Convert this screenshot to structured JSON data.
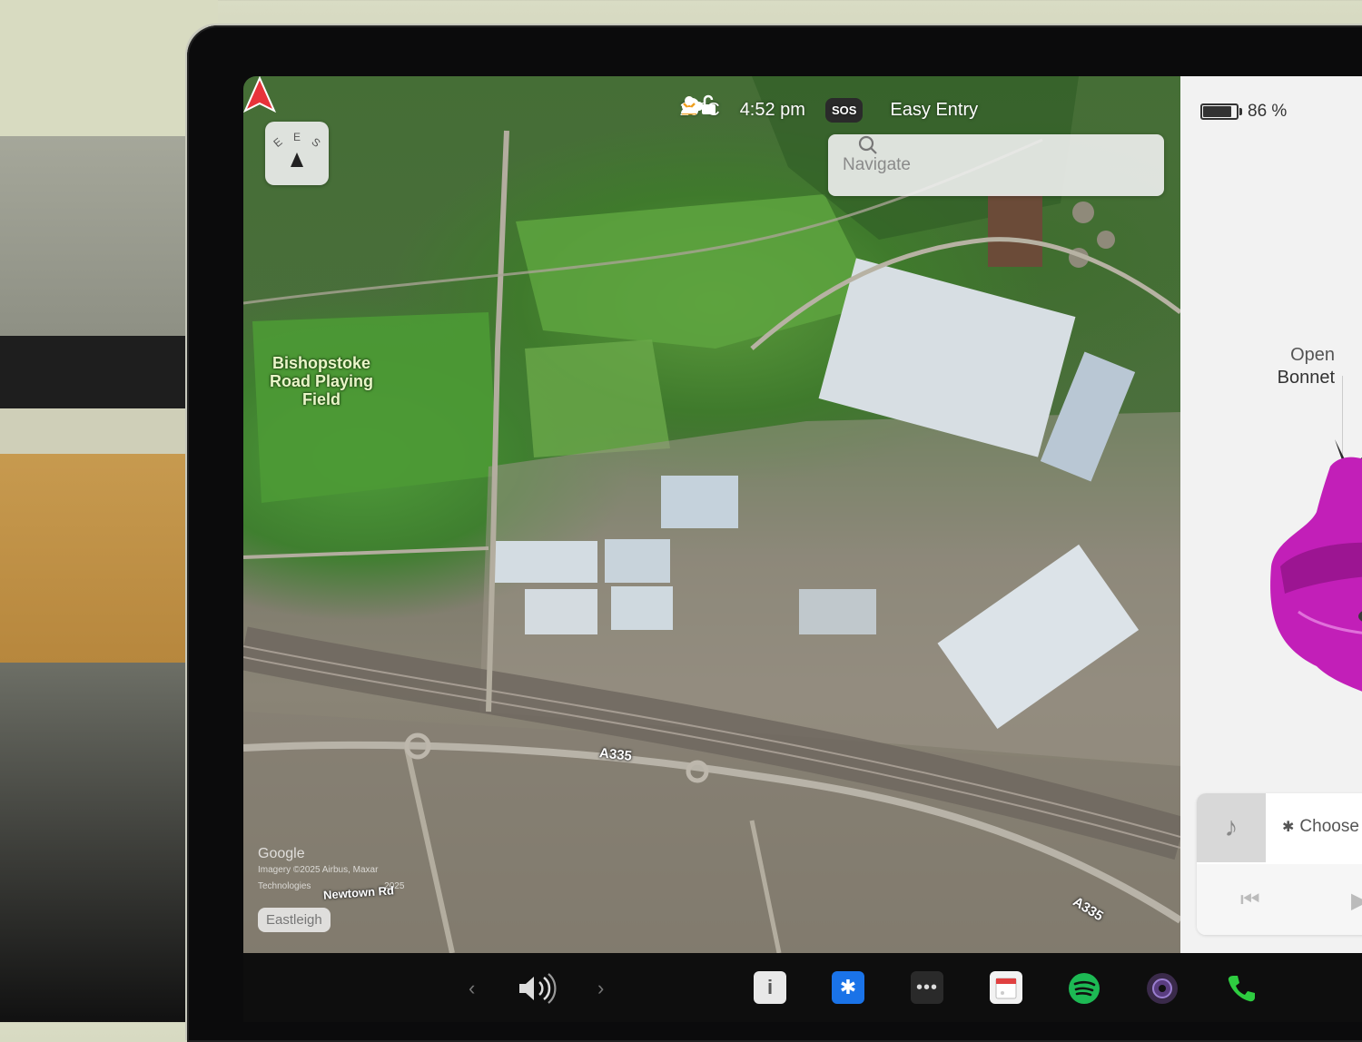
{
  "status_bar": {
    "temperature": "19°C",
    "time": "4:52 pm",
    "sos_label": "SOS",
    "profile_name": "Easy Entry"
  },
  "navigate": {
    "placeholder": "Navigate"
  },
  "compass": {
    "letters": [
      "E",
      "E",
      "S"
    ]
  },
  "map": {
    "place_label": "Bishopstoke Road Playing Field",
    "road_labels": [
      "A335",
      "A335",
      "Newtown Rd"
    ],
    "attribution_brand": "Google",
    "attribution_line1": "Imagery ©2025 Airbus, Maxar",
    "attribution_line2": "Technologies",
    "attribution_year": "2025",
    "city_chip": "Eastleigh"
  },
  "panel": {
    "battery_percent": "86 %",
    "battery_level": 0.86,
    "bonnet_line1": "Open",
    "bonnet_line2": "Bonnet",
    "media_source": "Choose"
  },
  "colors": {
    "position_arrow": "#e8333a",
    "car_body": "#c21fb8",
    "download_icon": "#f0a020",
    "bluetooth_tile": "#1a73e8",
    "spotify": "#1db954",
    "phone": "#2ecc40"
  },
  "dock": {
    "icons": [
      "chevron-left-icon",
      "volume-icon",
      "chevron-right-icon",
      "manual-icon",
      "bluetooth-icon",
      "more-icon",
      "calendar-icon",
      "spotify-icon",
      "camera-icon",
      "phone-icon"
    ]
  }
}
